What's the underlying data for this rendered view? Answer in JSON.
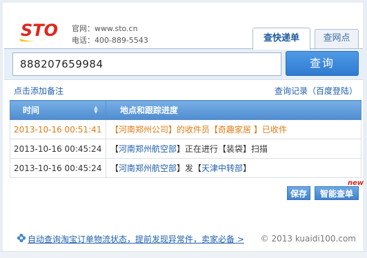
{
  "brand": {
    "logo_text": "STO",
    "website": "官网：www.sto.cn",
    "phone": "电话：400-889-5543",
    "colors": {
      "logo_red": "#e0261c",
      "logo_yellow": "#f7c21b"
    }
  },
  "tabs": [
    {
      "label": "查快递单",
      "active": true
    },
    {
      "label": "查网点",
      "active": false
    }
  ],
  "search": {
    "value": "888207659984",
    "button_label": "查询"
  },
  "links": {
    "add_note": "点击添加备注",
    "history": "查询记录（百度登陆）"
  },
  "table": {
    "columns": [
      "时间",
      "地点和跟踪进度"
    ],
    "rows": [
      {
        "time": "2013-10-16 00:51:41",
        "parts": [
          "【",
          "河南郑州公司",
          "】的收件员【",
          "奇趣家居 ",
          "】已收件"
        ],
        "latest": true
      },
      {
        "time": "2013-10-16 00:45:24",
        "parts": [
          "【",
          "河南郑州航空部",
          "】正在进行【装袋】扫描"
        ],
        "latest": false
      },
      {
        "time": "2013-10-16 00:45:24",
        "parts": [
          "【",
          "河南郑州航空部",
          "】发【",
          "天津中转部",
          "】"
        ],
        "latest": false
      }
    ]
  },
  "actions": {
    "save_label": "保存",
    "smart_label": "智能查单",
    "new_tag": "new"
  },
  "footer": {
    "promo_link": "自动查询淘宝订单物流状态，提前发现异常件，卖家必备 >",
    "copyright": "© 2013 kuaidi100.com"
  },
  "colors": {
    "accent_blue": "#2f7bd0",
    "link_blue": "#1f5fad",
    "latest_orange": "#e07a14"
  }
}
